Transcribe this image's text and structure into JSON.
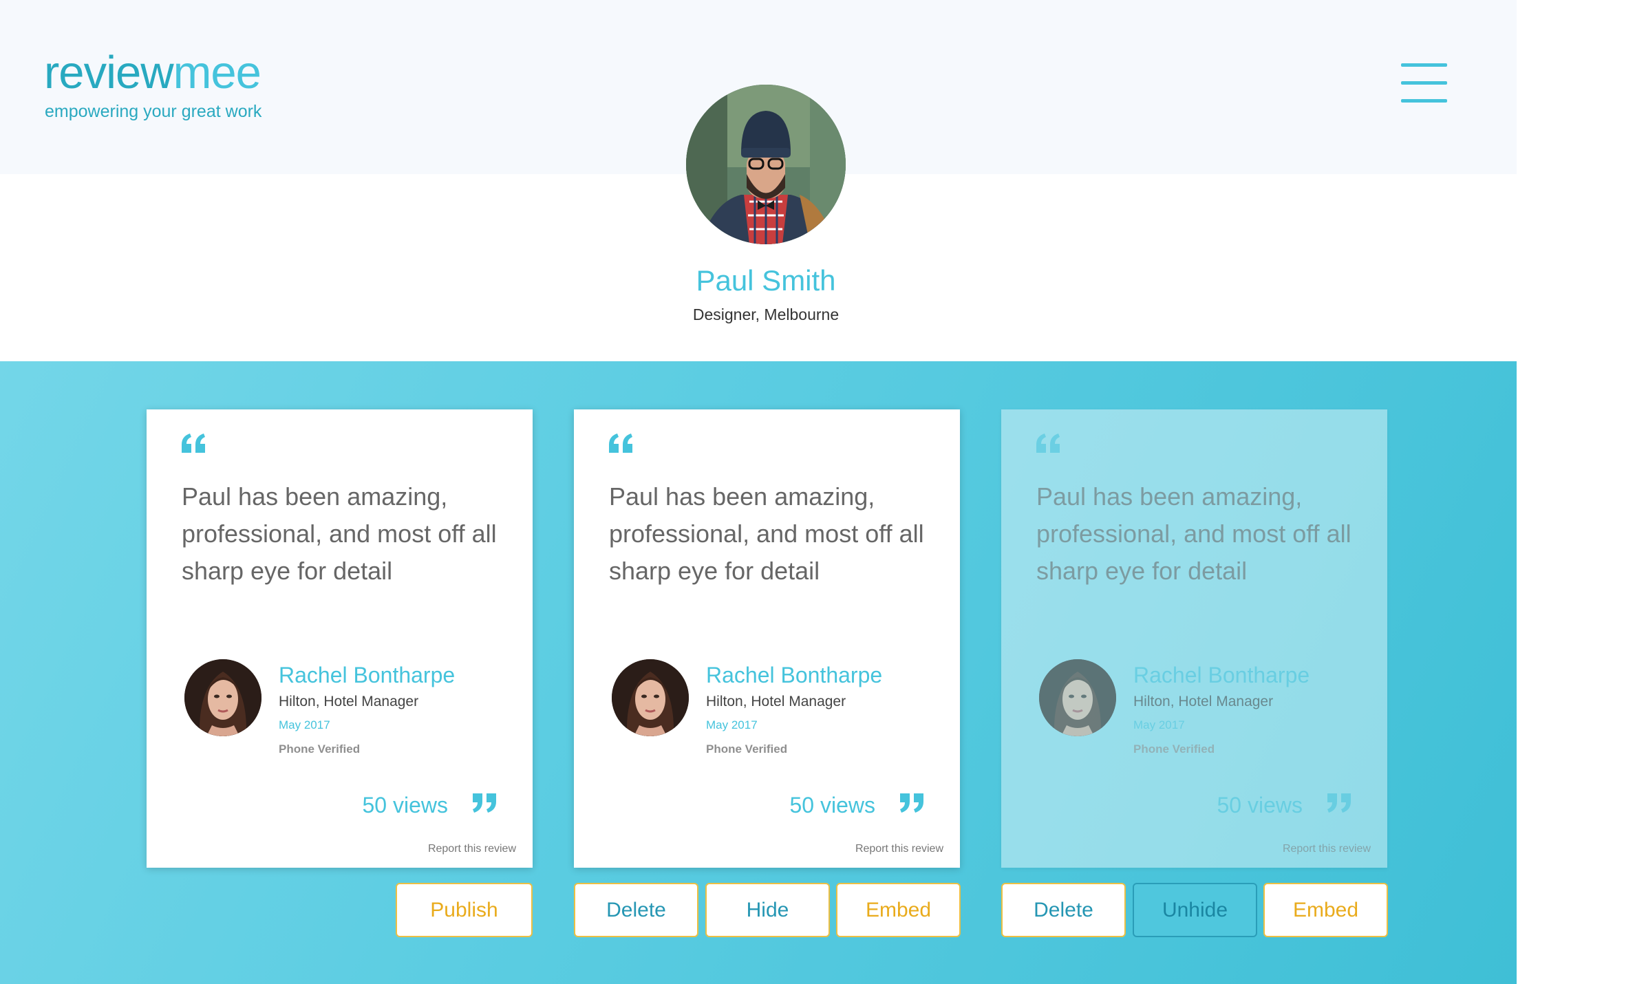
{
  "brand": {
    "logo_part1": "review",
    "logo_part2": "mee",
    "tagline": "empowering your great work"
  },
  "profile": {
    "name": "Paul Smith",
    "role": "Designer, Melbourne"
  },
  "reviews": [
    {
      "text": "Paul has been amazing, professional, and most off all sharp eye for detail",
      "reviewer_name": "Rachel Bontharpe",
      "reviewer_role": "Hilton, Hotel Manager",
      "date": "May 2017",
      "verified": "Phone Verified",
      "views": "50 views",
      "report": "Report this review",
      "hidden": false,
      "actions": [
        "Publish"
      ]
    },
    {
      "text": "Paul has been amazing, professional, and most off all sharp eye for detail",
      "reviewer_name": "Rachel Bontharpe",
      "reviewer_role": "Hilton, Hotel Manager",
      "date": "May 2017",
      "verified": "Phone Verified",
      "views": "50 views",
      "report": "Report this review",
      "hidden": false,
      "actions": [
        "Delete",
        "Hide",
        "Embed"
      ]
    },
    {
      "text": "Paul has been amazing, professional, and most off all sharp eye for detail",
      "reviewer_name": "Rachel Bontharpe",
      "reviewer_role": "Hilton, Hotel Manager",
      "date": "May 2017",
      "verified": "Phone Verified",
      "views": "50 views",
      "report": "Report this review",
      "hidden": true,
      "actions": [
        "Delete",
        "Unhide",
        "Embed"
      ]
    }
  ],
  "colors": {
    "accent": "#45c3dc",
    "band": "#5ccde2",
    "button_border": "#ecbf43",
    "publish_text": "#e9ab1c"
  }
}
